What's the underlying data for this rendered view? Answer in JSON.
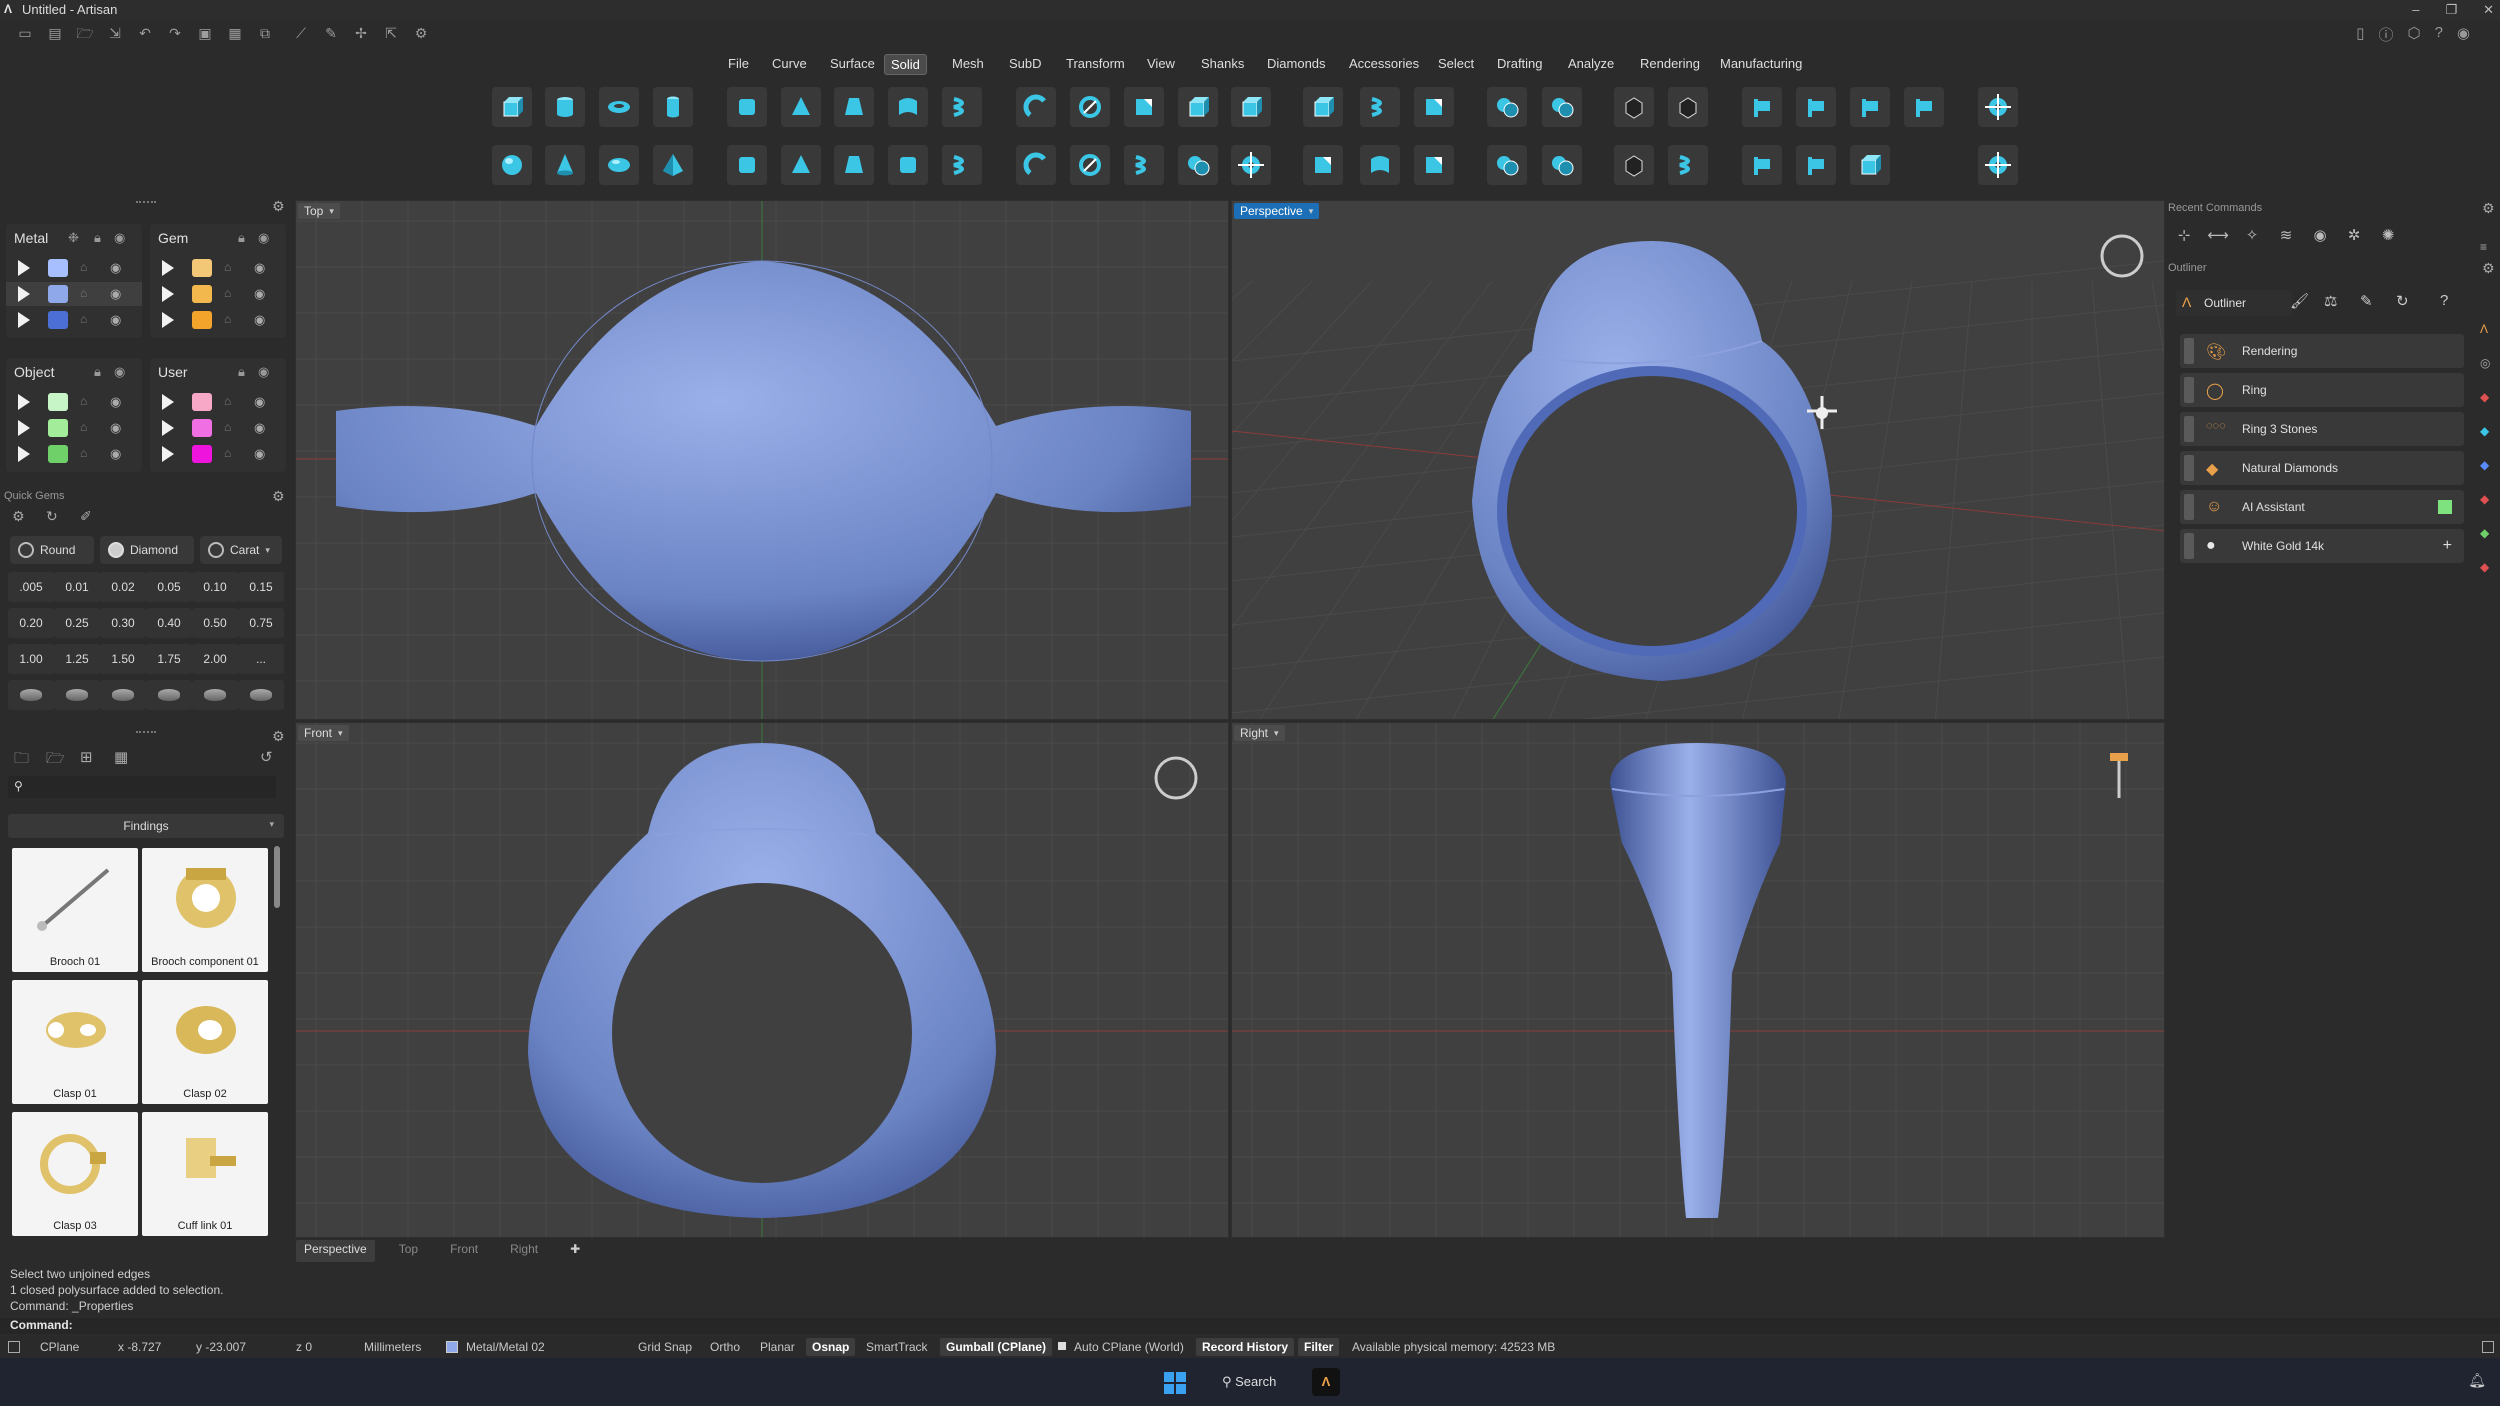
{
  "window": {
    "title": "Untitled - Artisan"
  },
  "menu": [
    {
      "label": "File"
    },
    {
      "label": "Curve"
    },
    {
      "label": "Surface"
    },
    {
      "label": "Solid",
      "active": true
    },
    {
      "label": "Mesh"
    },
    {
      "label": "SubD"
    },
    {
      "label": "Transform"
    },
    {
      "label": "View"
    },
    {
      "label": "Shanks"
    },
    {
      "label": "Diamonds"
    },
    {
      "label": "Accessories"
    },
    {
      "label": "Select"
    },
    {
      "label": "Drafting"
    },
    {
      "label": "Analyze"
    },
    {
      "label": "Rendering"
    },
    {
      "label": "Manufacturing"
    }
  ],
  "layers": {
    "metal": {
      "title": "Metal",
      "colors": [
        "#a7bfff",
        "#8ea8ea",
        "#4c6fd6"
      ]
    },
    "gem": {
      "title": "Gem",
      "colors": [
        "#f2c776",
        "#f2b84e",
        "#f2a52a"
      ]
    },
    "object": {
      "title": "Object",
      "colors": [
        "#c8f5c8",
        "#a2ec9a",
        "#6fd06a"
      ]
    },
    "user": {
      "title": "User",
      "colors": [
        "#f7a8c6",
        "#f06fe2",
        "#ee14de"
      ]
    }
  },
  "quick_gems": {
    "title": "Quick Gems",
    "shape_label": "Round",
    "type_label": "Diamond",
    "unit_label": "Carat",
    "values": [
      ".005",
      "0.01",
      "0.02",
      "0.05",
      "0.10",
      "0.15",
      "0.20",
      "0.25",
      "0.30",
      "0.40",
      "0.50",
      "0.75",
      "1.00",
      "1.25",
      "1.50",
      "1.75",
      "2.00",
      "..."
    ]
  },
  "library": {
    "category": "Findings",
    "search_placeholder": "",
    "items": [
      {
        "label": "Brooch 01"
      },
      {
        "label": "Brooch component 01"
      },
      {
        "label": "Clasp 01"
      },
      {
        "label": "Clasp 02"
      },
      {
        "label": "Clasp 03"
      },
      {
        "label": "Cuff link 01"
      }
    ]
  },
  "viewports": {
    "top": "Top",
    "perspective": "Perspective",
    "front": "Front",
    "right": "Right"
  },
  "viewport_tabs": [
    "Perspective",
    "Top",
    "Front",
    "Right"
  ],
  "recent_commands": {
    "title": "Recent Commands"
  },
  "outliner": {
    "panel_title": "Outliner",
    "tab_label": "Outliner",
    "items": [
      {
        "label": "Rendering",
        "icon": "palette-icon"
      },
      {
        "label": "Ring",
        "icon": "ring-icon"
      },
      {
        "label": "Ring 3 Stones",
        "icon": "ring-stones-icon"
      },
      {
        "label": "Natural Diamonds",
        "icon": "diamond-icon"
      },
      {
        "label": "AI Assistant",
        "icon": "ai-icon"
      },
      {
        "label": "White Gold 14k",
        "icon": "material-ball-icon"
      }
    ]
  },
  "command_history": [
    "Select two unjoined edges",
    "1 closed polysurface added to selection.",
    "Command: _Properties"
  ],
  "command_prompt": "Command:",
  "status": {
    "cplane": "CPlane",
    "x": "x -8.727",
    "y": "y -23.007",
    "z": "z 0",
    "units": "Millimeters",
    "layer": "Metal/Metal 02",
    "grid_snap": "Grid Snap",
    "ortho": "Ortho",
    "planar": "Planar",
    "osnap": "Osnap",
    "smarttrack": "SmartTrack",
    "gumball": "Gumball (CPlane)",
    "auto_cplane": "Auto CPlane (World)",
    "record_history": "Record History",
    "filter": "Filter",
    "memory": "Available physical memory: 42523 MB"
  },
  "taskbar": {
    "search": "Search"
  },
  "colors": {
    "accent": "#1c6fb6",
    "viewport_bg": "#404040",
    "ring": "#6b84c4",
    "tool_cyan": "#3bc6e6"
  }
}
